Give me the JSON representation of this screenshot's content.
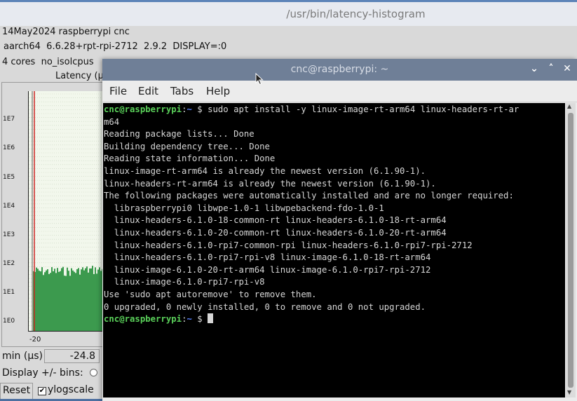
{
  "background_window": {
    "title": "/usr/bin/latency-histogram",
    "info_line1": "14May2024 raspberrypi cnc",
    "info_line2": "aarch64  6.6.28+rpt-rpi-2712  2.9.2  DISPLAY=:0",
    "info_line3": "4 cores  no_isolcpus",
    "plot_title": "Latency (µ",
    "y_ticks": [
      "1E7",
      "1E6",
      "1E5",
      "1E4",
      "1E3",
      "1E2",
      "1E1",
      "1E0"
    ],
    "x_tick": "-20",
    "min_label": "min (µs)",
    "min_value": "-24.8",
    "bins_label": "Display +/- bins:",
    "reset_label": "Reset",
    "ylogscale_label": "ylogscale",
    "ylogscale_checked": "✔",
    "colors": {
      "plot_bg": "#f2f7ec",
      "bars": "#3c9a4e",
      "marker": "#cc2222"
    }
  },
  "terminal": {
    "title": "cnc@raspberrypi: ~",
    "controls": {
      "minimize": "⌄",
      "maximize": "˄",
      "close": "✕"
    },
    "menu": {
      "file": "File",
      "edit": "Edit",
      "tabs": "Tabs",
      "help": "Help"
    },
    "prompt_user": "cnc@raspberrypi",
    "prompt_sep": ":",
    "prompt_path": "~",
    "prompt_symbol": " $ ",
    "command": "sudo apt install -y linux-image-rt-arm64 linux-headers-rt-ar",
    "command_wrap": "m64",
    "output": [
      "Reading package lists... Done",
      "Building dependency tree... Done",
      "Reading state information... Done",
      "linux-image-rt-arm64 is already the newest version (6.1.90-1).",
      "linux-headers-rt-arm64 is already the newest version (6.1.90-1).",
      "The following packages were automatically installed and are no longer required:",
      "  libraspberrypi0 libwpe-1.0-1 libwpebackend-fdo-1.0-1",
      "  linux-headers-6.1.0-18-common-rt linux-headers-6.1.0-18-rt-arm64",
      "  linux-headers-6.1.0-20-common-rt linux-headers-6.1.0-20-rt-arm64",
      "  linux-headers-6.1.0-rpi7-common-rpi linux-headers-6.1.0-rpi7-rpi-2712",
      "  linux-headers-6.1.0-rpi7-rpi-v8 linux-image-6.1.0-18-rt-arm64",
      "  linux-image-6.1.0-20-rt-arm64 linux-image-6.1.0-rpi7-rpi-2712",
      "  linux-image-6.1.0-rpi7-rpi-v8",
      "Use 'sudo apt autoremove' to remove them.",
      "0 upgraded, 0 newly installed, 0 to remove and 0 not upgraded."
    ],
    "colors": {
      "prompt": "#5ad15a",
      "path": "#5a82ff",
      "text": "#d6d6d6",
      "titlebar": "#6f7f97"
    }
  }
}
